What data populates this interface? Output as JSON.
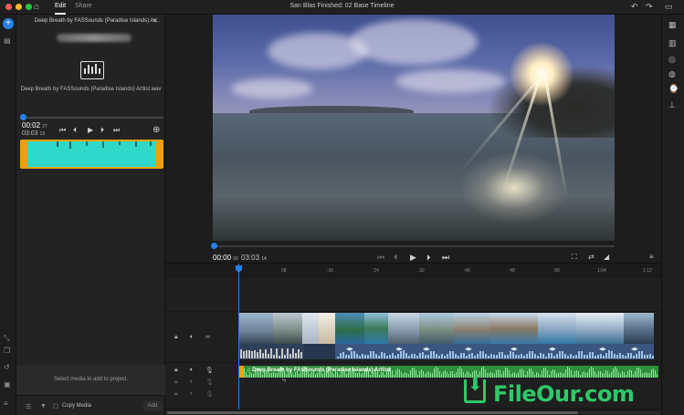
{
  "window": {
    "title": "San Blas Finished: 02 Base Timeline",
    "tabs": [
      {
        "label": "Edit"
      },
      {
        "label": "Share"
      }
    ],
    "colors": {
      "red": "#ff5f57",
      "yellow": "#febc2e",
      "green": "#28c840",
      "accent": "#2680eb",
      "clip_orange": "#f0a000"
    }
  },
  "source_panel": {
    "clip_title": "Deep Breath by FASSounds (Paradise Islands) Ar...",
    "clip_name": "Deep Breath by FASSounds (Paradise Islands) Artlist.wav",
    "time_current": "00:02",
    "time_current_frames": "27",
    "time_duration": "03:03",
    "time_duration_frames": "13",
    "empty_message": "Select media to add to project.",
    "copy_media_label": "Copy Media",
    "add_label": "Add"
  },
  "monitor": {
    "time_current": "00:00",
    "time_current_frames": "00",
    "time_duration": "03:03",
    "time_duration_frames": "14"
  },
  "timeline": {
    "ruler_ticks": [
      "08",
      ":16",
      ":24",
      ":32",
      ":40",
      ":48",
      ":56",
      "1:04",
      "1:12"
    ],
    "music_clip_label": "Deep Breath by FASSounds (Paradise Islands) Artlist"
  },
  "icons": {
    "home": "home-icon",
    "undo": "undo-icon",
    "redo": "redo-icon",
    "chat": "chat-icon",
    "add": "plus-icon"
  },
  "watermark": {
    "text": "FileOur.com"
  }
}
